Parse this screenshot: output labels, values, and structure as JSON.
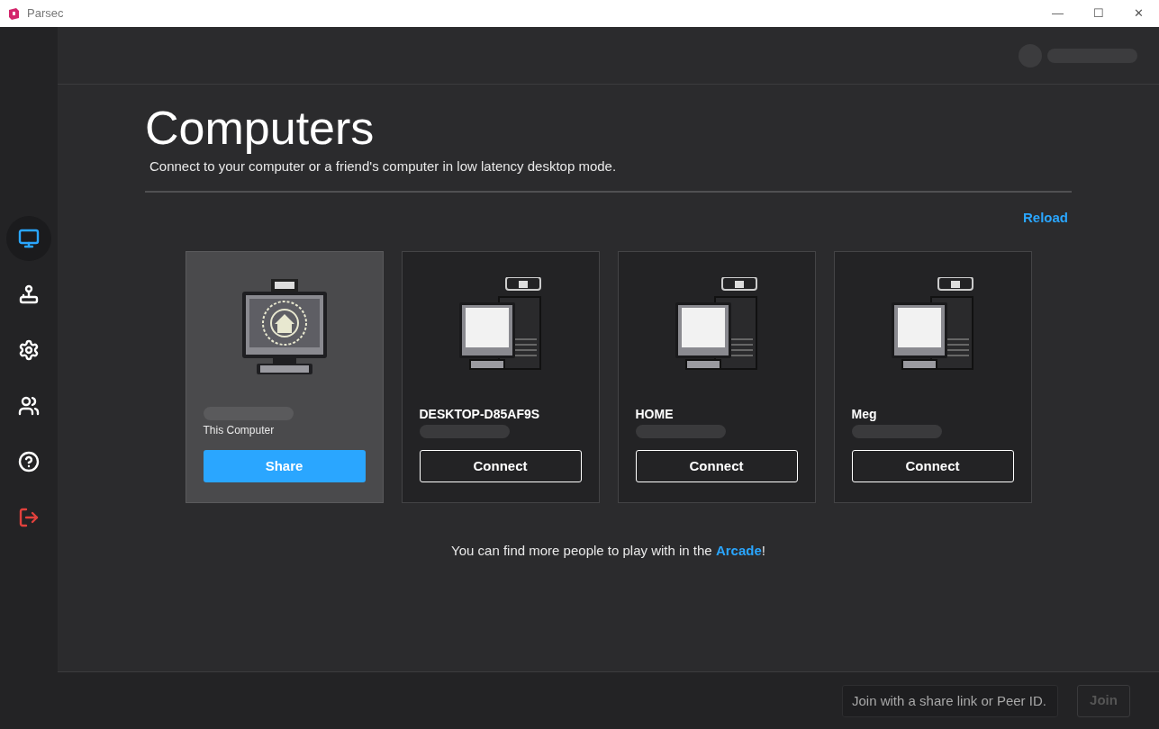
{
  "window": {
    "title": "Parsec",
    "controls": [
      "—",
      "☐",
      "✕"
    ]
  },
  "sidebar": {
    "items": [
      {
        "kind": "computers",
        "selected": true
      },
      {
        "kind": "arcade",
        "selected": false
      },
      {
        "kind": "settings",
        "selected": false
      },
      {
        "kind": "friends",
        "selected": false
      },
      {
        "kind": "help",
        "selected": false
      },
      {
        "kind": "logout",
        "selected": false
      }
    ]
  },
  "page": {
    "title": "Computers",
    "subtitle": "Connect to your computer or a friend's computer in low latency desktop mode.",
    "reload": "Reload"
  },
  "computers": [
    {
      "kind": "local",
      "caption": "This Computer",
      "button": "Share",
      "selected": true
    },
    {
      "kind": "remote",
      "name": "DESKTOP-D85AF9S",
      "button": "Connect",
      "selected": false
    },
    {
      "kind": "remote",
      "name": "HOME",
      "button": "Connect",
      "selected": false
    },
    {
      "kind": "remote",
      "name": "Meg",
      "button": "Connect",
      "selected": false
    }
  ],
  "footer_note": {
    "text": "You can find more people to play with in the ",
    "link": "Arcade",
    "end": "!"
  },
  "join": {
    "placeholder": "Join with a share link or Peer ID.",
    "button": "Join",
    "disabled": true
  }
}
